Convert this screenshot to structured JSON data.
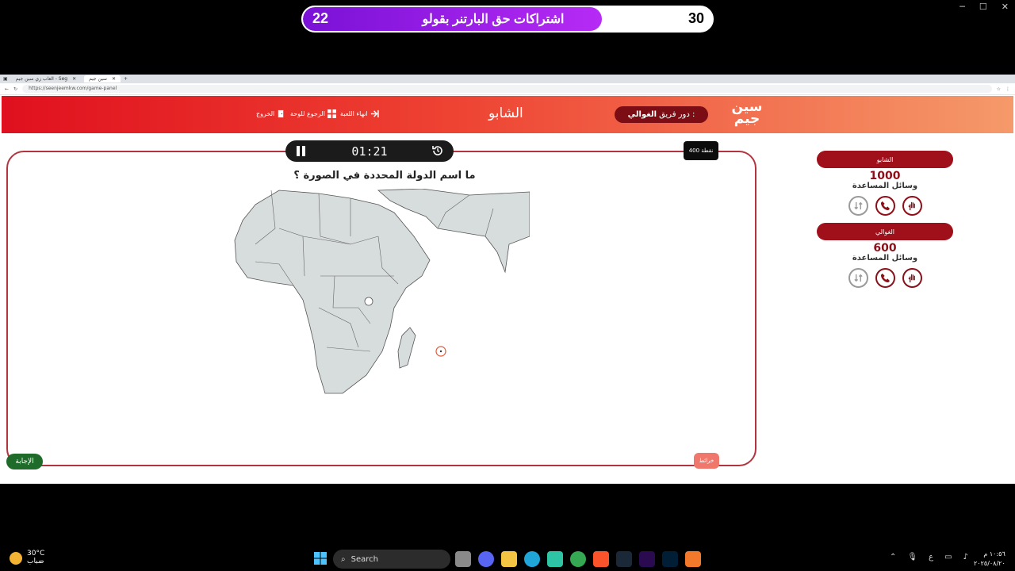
{
  "overlay": {
    "title": "اشتراكات حق البارتنر بقولو",
    "left_number": "22",
    "right_number": "30",
    "progress": 0.73
  },
  "browser": {
    "tabs": [
      {
        "label": "العاب زي سين جيم - Seg"
      },
      {
        "label": "سين جيم"
      }
    ],
    "url": "https://seenjeemkw.com/game-panel"
  },
  "header": {
    "logo": "سين جيم",
    "turn_prefix": "دور فريق :",
    "turn_team": "الغوالي",
    "current_team": "الشابو",
    "end_game": "انهاء اللعبة",
    "back_to_board": "الرجوع للوحة",
    "exit": "الخروج"
  },
  "board": {
    "timer": "01:21",
    "points": "400 نقطة",
    "question": "ما اسم الدولة المحددة في الصورة ؟",
    "answer_button": "الإجابة",
    "map_button": "خرائط"
  },
  "teams": [
    {
      "name": "الشابو",
      "score": "1000",
      "help_label": "وسائل المساعدة"
    },
    {
      "name": "الغوالي",
      "score": "600",
      "help_label": "وسائل المساعدة"
    }
  ],
  "icons": {
    "lifelines": [
      "swap-arrows-icon",
      "phone-icon",
      "hand-icon"
    ]
  },
  "taskbar": {
    "temperature": "30°C",
    "weather_text": "ضباب",
    "search_placeholder": "Search",
    "language": "ع",
    "time": "١٠:٥٦ م",
    "date": "٢٠٢٥/٠٨/٢٠"
  },
  "colors": {
    "brand_red": "#e0101e",
    "dark_red": "#a0101a",
    "answer_green": "#1f6b2a",
    "overlay_purple": "#9b22e8"
  }
}
